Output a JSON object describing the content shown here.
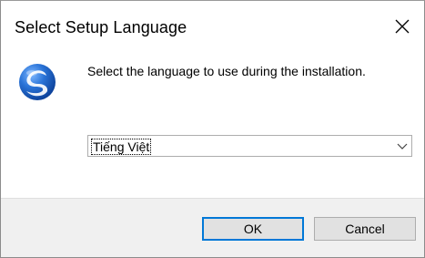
{
  "window": {
    "title": "Select Setup Language",
    "close_icon": "close-icon"
  },
  "content": {
    "app_icon": "setup-logo-icon",
    "message": "Select the language to use during the installation."
  },
  "language_select": {
    "selected": "Tiếng Việt",
    "arrow_icon": "chevron-down-icon"
  },
  "buttons": {
    "ok_label": "OK",
    "cancel_label": "Cancel"
  },
  "colors": {
    "focus_border": "#0078d7",
    "footer_bg": "#f0f0f0",
    "button_bg": "#e1e1e1",
    "logo_primary": "#1e63c4"
  }
}
